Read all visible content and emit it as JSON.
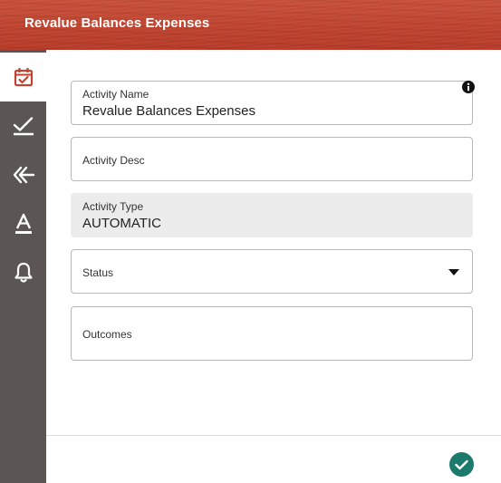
{
  "header": {
    "title": "Revalue Balances Expenses"
  },
  "sidebar": {
    "items": [
      {
        "icon": "calendar-check-icon",
        "active": true
      },
      {
        "icon": "checklist-icon",
        "active": false
      },
      {
        "icon": "double-chevron-left-icon",
        "active": false
      },
      {
        "icon": "text-format-icon",
        "active": false
      },
      {
        "icon": "bell-icon",
        "active": false
      }
    ]
  },
  "form": {
    "activity_name": {
      "label": "Activity Name",
      "value": "Revalue Balances Expenses"
    },
    "activity_desc": {
      "label": "Activity Desc",
      "value": ""
    },
    "activity_type": {
      "label": "Activity Type",
      "value": "AUTOMATIC"
    },
    "status": {
      "label": "Status",
      "value": ""
    },
    "outcomes": {
      "label": "Outcomes",
      "value": ""
    }
  },
  "actions": {
    "confirm_icon": "check-icon"
  },
  "colors": {
    "header": "#c1432f",
    "sidebar": "#5b5654",
    "active_icon": "#c1432f",
    "confirm": "#1c7a6c"
  }
}
